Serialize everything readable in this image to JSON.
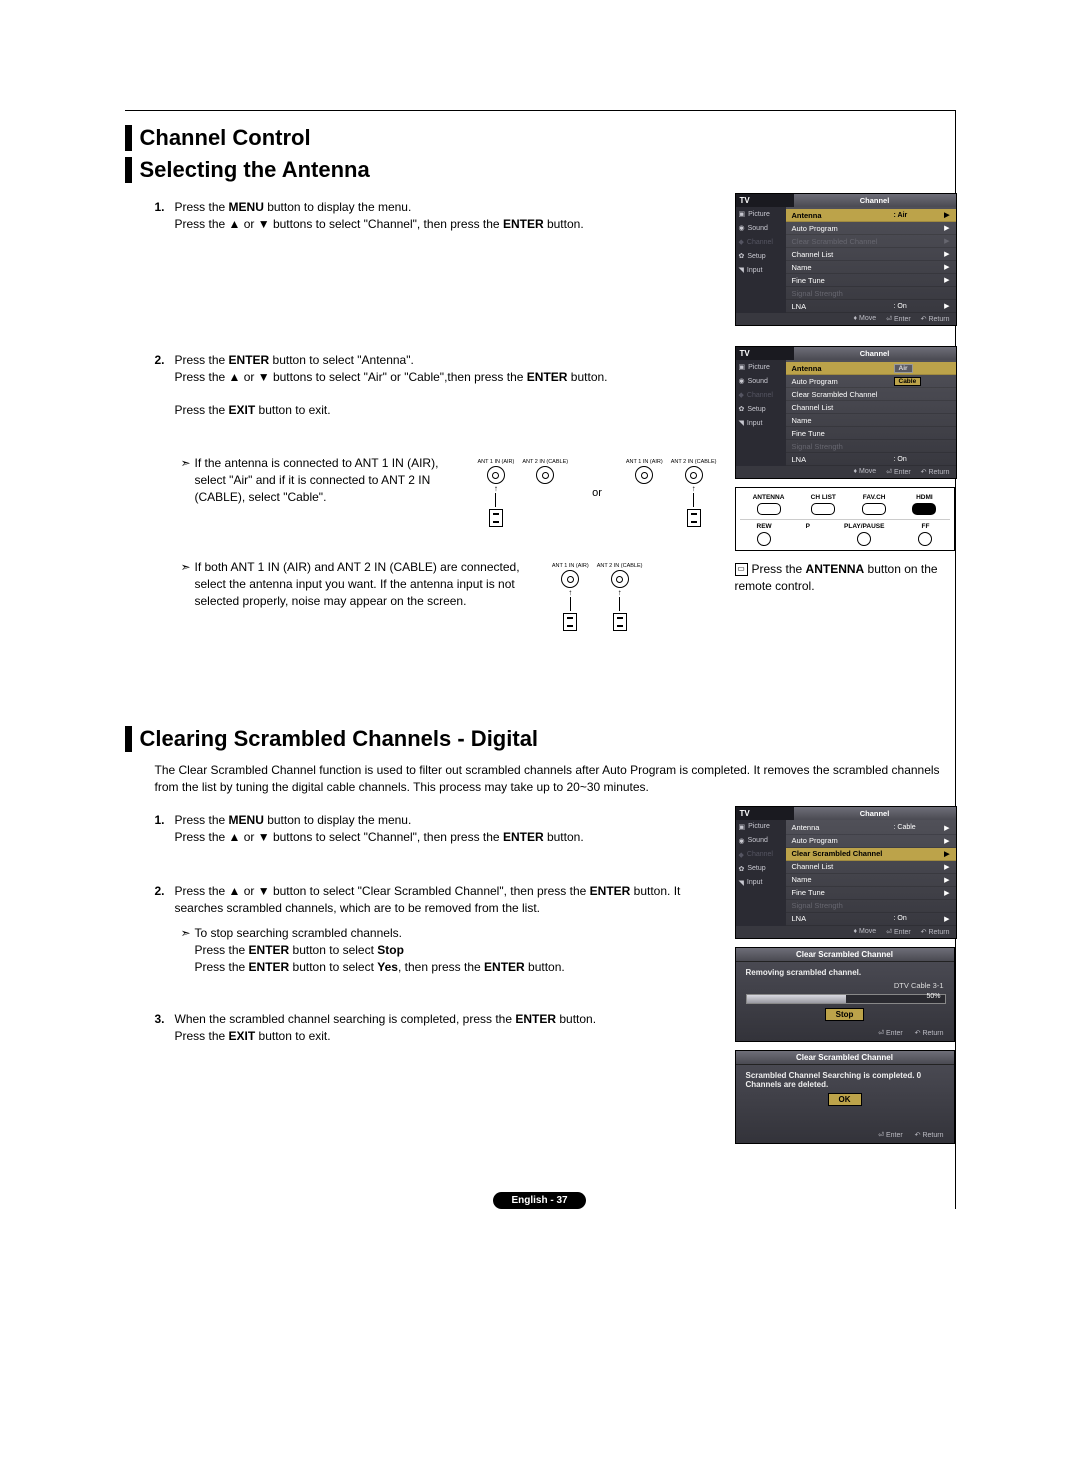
{
  "section_title": "Channel Control",
  "heading1": "Selecting the Antenna",
  "step1_1_a": "Press the ",
  "step1_1_menu": "MENU",
  "step1_1_b": " button to display the menu.",
  "step1_1_c": "Press the ▲ or ▼ buttons to select \"Channel\", then press the ",
  "step1_1_enter": "ENTER",
  "step1_1_d": " button.",
  "step1_2_a": "Press the ",
  "step1_2_b": " button to select \"Antenna\".",
  "step1_2_c": "Press the ▲ or ▼  buttons to select \"Air\" or \"Cable\",then press the ",
  "step1_2_d": " button.",
  "step1_2_e": "Press the ",
  "step1_2_exit": "EXIT",
  "step1_2_f": " button to exit.",
  "note1": "If the antenna is connected to ANT 1 IN (AIR), select \"Air\" and if it is connected to ANT 2 IN (CABLE), select \"Cable\".",
  "or_label": "or",
  "note2_a": "If both ANT 1 IN (AIR) and ANT 2 IN (CABLE) are connected, select the antenna input you want. If the antenna input is not selected properly, noise may appear on the screen.",
  "remote_note_a": "Press the ",
  "remote_note_btn": "ANTENNA",
  "remote_note_b": " button on the remote control.",
  "menu": {
    "tv": "TV",
    "channel": "Channel",
    "picture": "Picture",
    "sound": "Sound",
    "channel_icon": "Channel",
    "setup": "Setup",
    "input": "Input",
    "antenna": "Antenna",
    "auto_program": "Auto Program",
    "clear_scrambled": "Clear Scrambled Channel",
    "channel_list": "Channel List",
    "name": "Name",
    "fine_tune": "Fine Tune",
    "signal_strength": "Signal Strength",
    "lna": "LNA",
    "air": ": Air",
    "cable": ": Cable",
    "air_pill": "Air",
    "cable_pill": "Cable",
    "on": ": On",
    "move": "Move",
    "enter": "Enter",
    "return": "Return"
  },
  "remote": {
    "antenna": "ANTENNA",
    "chlist": "CH LIST",
    "favch": "FAV.CH",
    "hdmi": "HDMI",
    "rew": "REW",
    "p": "P",
    "playpause": "PLAY/PAUSE",
    "ff": "FF"
  },
  "conn": {
    "ant1_air": "ANT 1 IN (AIR)",
    "ant2_cable": "ANT 2 IN (CABLE)"
  },
  "heading2": "Clearing Scrambled Channels - Digital",
  "intro2": "The Clear Scrambled Channel function is used to filter out scrambled channels after Auto Program is completed. It removes the scrambled channels from the list by tuning the digital cable channels. This process may take up to 20~30 minutes.",
  "step2_1_a": "Press the ",
  "step2_1_b": " button to display the menu.",
  "step2_1_c": "Press the ▲ or ▼ buttons to select \"Channel\", then press the ",
  "step2_1_d": " button.",
  "step2_2_a": "Press the ▲ or ▼ button to select \"Clear Scrambled Channel\", then press the ",
  "step2_2_b": " button. It searches scrambled channels, which are to be removed from the list.",
  "step2_note_a": "To stop searching scrambled channels.",
  "step2_note_b": "Press the ",
  "step2_note_c": " button to select ",
  "step2_note_stop": "Stop",
  "step2_note_d": "Press the ",
  "step2_note_e": " button to select ",
  "step2_note_yes": "Yes",
  "step2_note_f": ", then press the ",
  "step2_note_g": " button.",
  "step2_3_a": "When the scrambled channel searching is completed, press the ",
  "step2_3_b": " button.",
  "step2_3_c": "Press the ",
  "step2_3_d": " button to exit.",
  "popup1": {
    "title": "Clear Scrambled Channel",
    "msg": "Removing scrambled channel.",
    "sub": "DTV Cable 3-1",
    "progress": "50%",
    "btn": "Stop",
    "enter": "Enter",
    "return": "Return"
  },
  "popup2": {
    "title": "Clear Scrambled Channel",
    "msg": "Scrambled Channel Searching is completed. 0 Channels are deleted.",
    "btn": "OK",
    "enter": "Enter",
    "return": "Return"
  },
  "num1": "1.",
  "num2": "2.",
  "num3": "3.",
  "arrow": "➣",
  "footer": "English - 37"
}
